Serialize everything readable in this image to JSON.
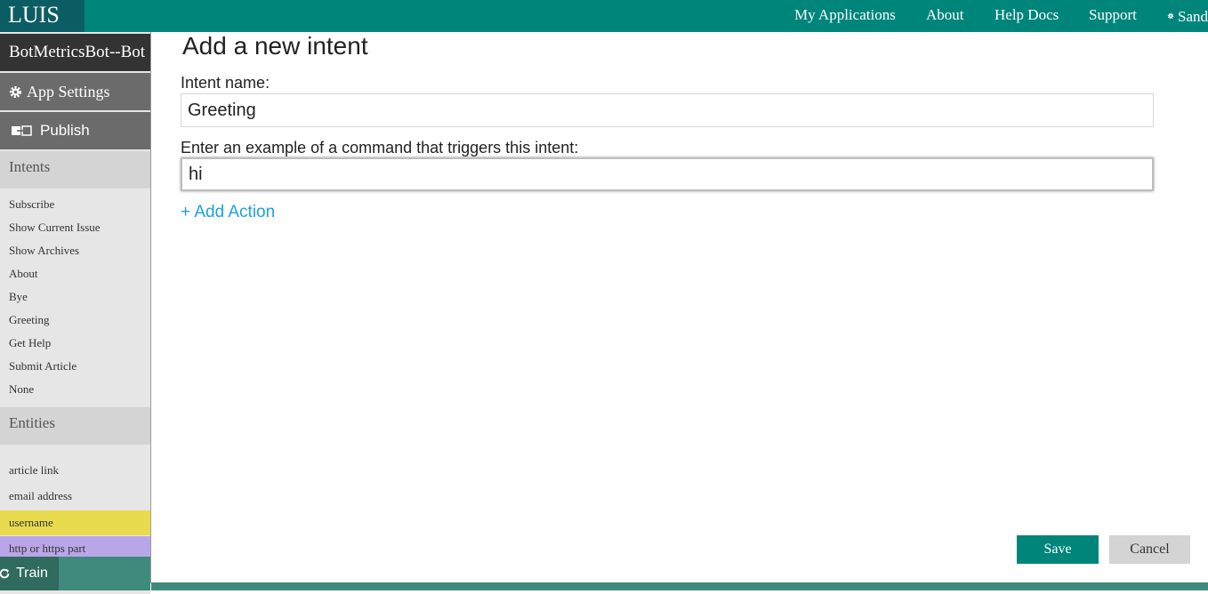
{
  "topbar": {
    "logo": "LUIS",
    "nav": [
      "My Applications",
      "About",
      "Help Docs",
      "Support"
    ],
    "user_label": "Sand"
  },
  "sidebar": {
    "app_name": "BotMetricsBot--Bot",
    "app_settings": "App Settings",
    "publish": "Publish",
    "intents_header": "Intents",
    "intents": [
      "Subscribe",
      "Show Current Issue",
      "Show Archives",
      "About",
      "Bye",
      "Greeting",
      "Get Help",
      "Submit Article",
      "None"
    ],
    "entities_header": "Entities",
    "entities": [
      "article link",
      "email address",
      "username",
      "http or https part"
    ],
    "train": "Train"
  },
  "form": {
    "title": "Add a new intent",
    "intent_name_label": "Intent name:",
    "intent_name_value": "Greeting",
    "example_label": "Enter an example of a command that triggers this intent:",
    "example_value": "hi",
    "add_action": "+ Add Action",
    "save": "Save",
    "cancel": "Cancel"
  },
  "colors": {
    "header": "#00857a",
    "logo_bg": "#0b5d63",
    "link": "#1aa3d9",
    "username_highlight": "#e8dc4e",
    "http_highlight": "#b9a6e8"
  }
}
